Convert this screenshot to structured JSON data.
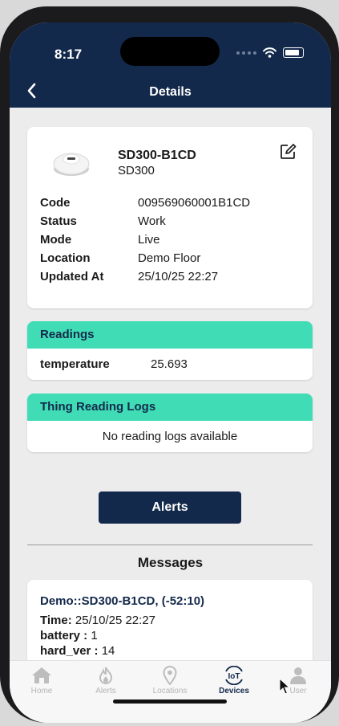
{
  "status_bar": {
    "time": "8:17"
  },
  "header": {
    "title": "Details"
  },
  "device": {
    "name": "SD300-B1CD",
    "model": "SD300",
    "details": [
      {
        "key": "Code",
        "value": "009569060001B1CD"
      },
      {
        "key": "Status",
        "value": "Work"
      },
      {
        "key": "Mode",
        "value": "Live"
      },
      {
        "key": "Location",
        "value": "Demo Floor"
      },
      {
        "key": "Updated At",
        "value": "25/10/25 22:27"
      }
    ]
  },
  "readings": {
    "title": "Readings",
    "items": [
      {
        "key": "temperature",
        "value": "25.693"
      }
    ]
  },
  "logs": {
    "title": "Thing Reading Logs",
    "empty_text": "No reading logs available"
  },
  "alerts_button": "Alerts",
  "messages": {
    "title": "Messages",
    "items": [
      {
        "header": "Demo::SD300-B1CD,  (-52:10)",
        "time_label": "Time:",
        "time_value": "25/10/25 22:27",
        "lines": [
          {
            "key": "battery :",
            "value": "1"
          },
          {
            "key": "hard_ver :",
            "value": "14"
          }
        ]
      }
    ]
  },
  "tabs": [
    {
      "label": "Home",
      "icon": "home-icon"
    },
    {
      "label": "Alerts",
      "icon": "flame-icon"
    },
    {
      "label": "Locations",
      "icon": "location-pin-icon"
    },
    {
      "label": "Devices",
      "icon": "iot-icon",
      "active": true
    },
    {
      "label": "User",
      "icon": "user-icon"
    }
  ],
  "colors": {
    "primary": "#13294b",
    "accent": "#3fdcb5",
    "background": "#ececec"
  }
}
